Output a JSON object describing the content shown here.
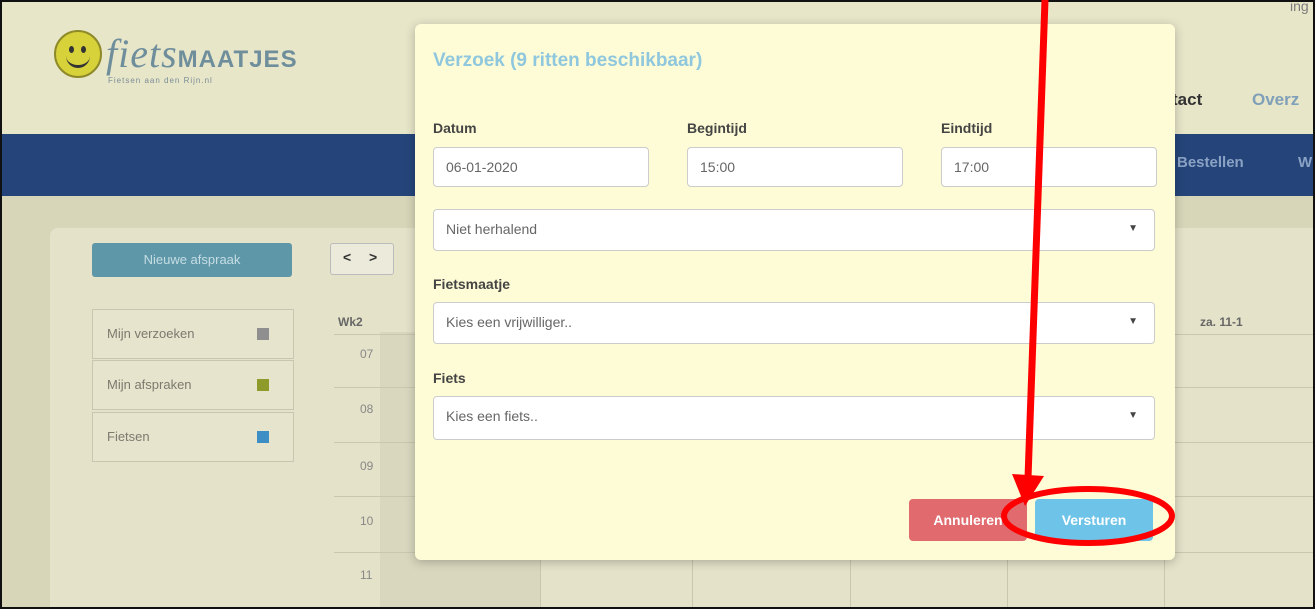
{
  "header": {
    "logo_text": "fiets",
    "logo_bold": "MAATJES",
    "logo_sub": "Fietsen aan den Rijn.nl",
    "user_fragment": "ing",
    "nav_top": [
      "tact",
      "Overz"
    ],
    "nav_main": [
      "Bestellen",
      "W"
    ]
  },
  "sidebar": {
    "new_button": "Nieuwe afspraak",
    "prev": "<",
    "next": ">",
    "legend": [
      {
        "label": "Mijn verzoeken",
        "color": "#8f8f8f"
      },
      {
        "label": "Mijn afspraken",
        "color": "#8e9a2a"
      },
      {
        "label": "Fietsen",
        "color": "#3c8ec4"
      }
    ]
  },
  "calendar": {
    "week": "Wk2",
    "day_header": "za. 11-1",
    "hours": [
      "07",
      "08",
      "09",
      "10",
      "11"
    ]
  },
  "modal": {
    "title": "Verzoek (9 ritten beschikbaar)",
    "datum_label": "Datum",
    "datum_value": "06-01-2020",
    "begintijd_label": "Begintijd",
    "begintijd_value": "15:00",
    "eindtijd_label": "Eindtijd",
    "eindtijd_value": "17:00",
    "repeat_value": "Niet herhalend",
    "fietsmaatje_label": "Fietsmaatje",
    "fietsmaatje_value": "Kies een vrijwilliger..",
    "fiets_label": "Fiets",
    "fiets_value": "Kies een fiets..",
    "cancel_label": "Annuleren",
    "send_label": "Versturen"
  },
  "colors": {
    "annotation": "#ff0000",
    "cancel": "#e06a6e",
    "send": "#6ec3e8",
    "navbar": "#25457a",
    "modal_bg": "#fefcd6"
  }
}
